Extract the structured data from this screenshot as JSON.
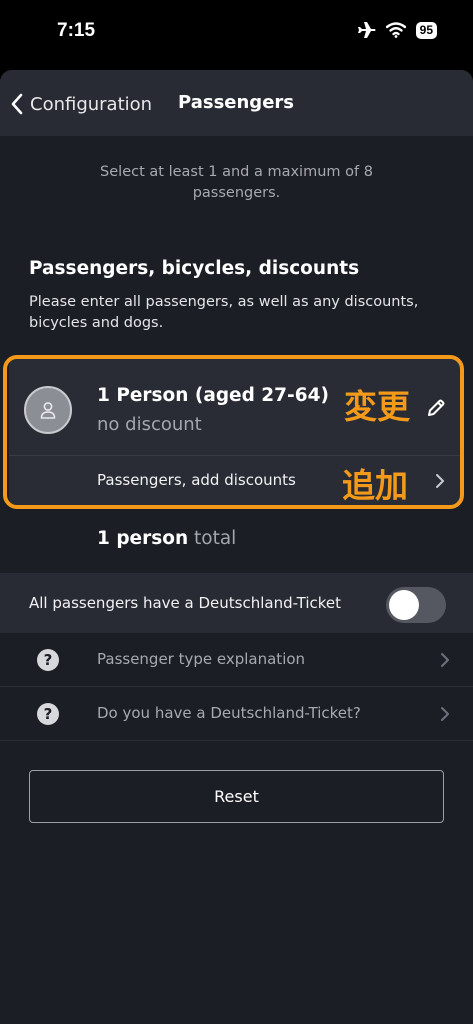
{
  "status_bar": {
    "time": "7:15",
    "battery": "95"
  },
  "header": {
    "back_label": "Configuration",
    "title": "Passengers"
  },
  "hint": "Select at least 1 and a maximum of 8 passengers.",
  "section": {
    "title": "Passengers, bicycles, discounts",
    "description": "Please enter all passengers, as well as any discounts, bicycles and dogs."
  },
  "passenger": {
    "title": "1 Person (aged 27-64)",
    "subtitle": "no discount",
    "annotation_change": "変更",
    "add_label": "Passengers, add discounts",
    "annotation_add": "追加"
  },
  "total": {
    "count": "1 person",
    "unit": "total"
  },
  "deutschland_toggle": {
    "label": "All passengers have a Deutschland-Ticket",
    "on": false
  },
  "info_rows": [
    {
      "label": "Passenger type explanation"
    },
    {
      "label": "Do you have a Deutschland-Ticket?"
    }
  ],
  "reset_label": "Reset",
  "colors": {
    "accent_annotation": "#f39a1a",
    "background": "#1b1e25",
    "surface": "#282b33"
  }
}
